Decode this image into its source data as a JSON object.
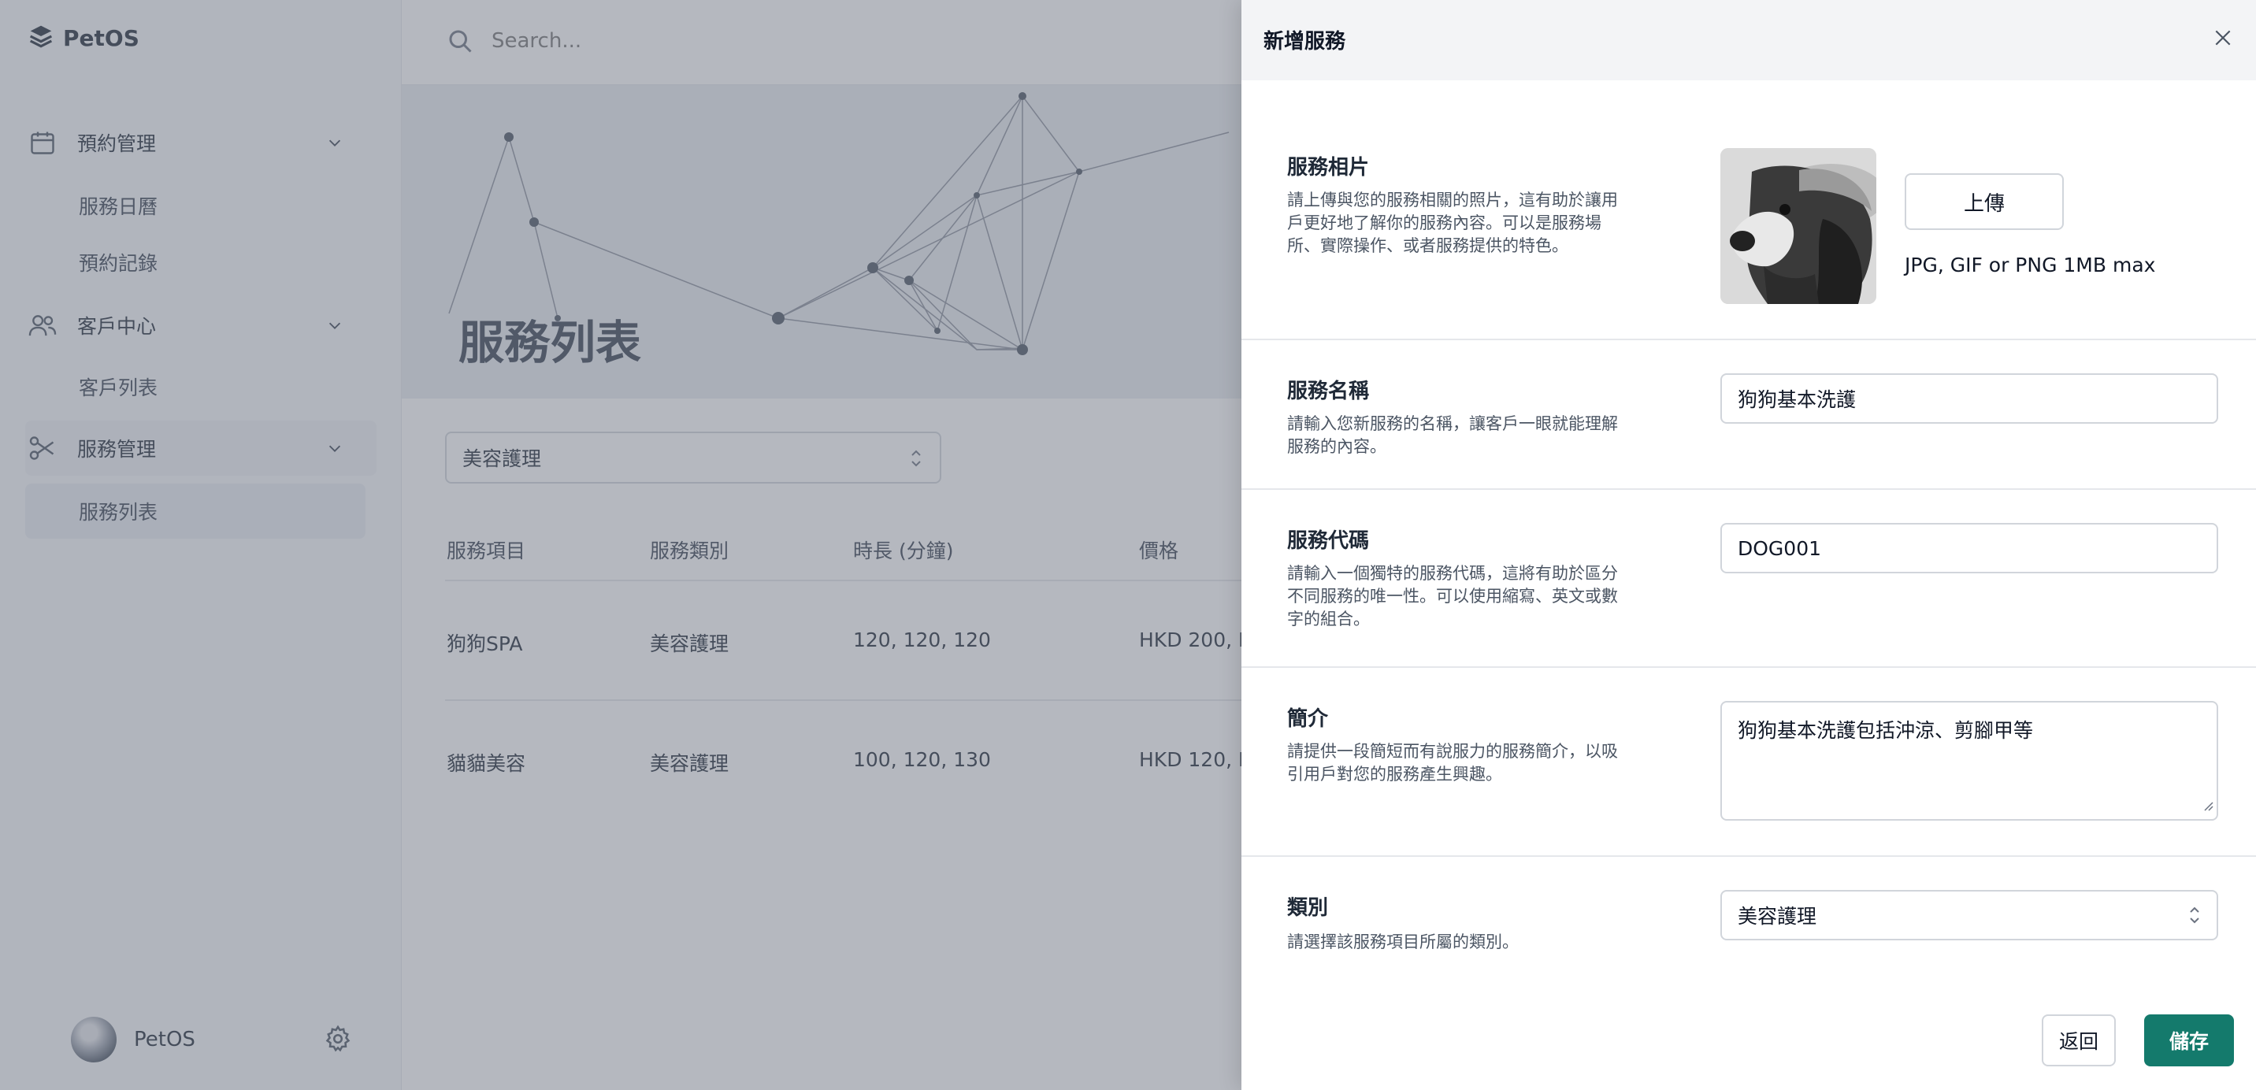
{
  "app": {
    "brand": "PetOS",
    "accent_color": "#147a6c"
  },
  "sidebar": {
    "groups": [
      {
        "label": "預約管理",
        "icon": "calendar-icon",
        "items": [
          "服務日曆",
          "預約記錄"
        ]
      },
      {
        "label": "客戶中心",
        "icon": "users-icon",
        "items": [
          "客戶列表"
        ]
      },
      {
        "label": "服務管理",
        "icon": "scissors-icon",
        "items": [
          "服務列表"
        ]
      }
    ],
    "active_item": "服務列表",
    "profile_name": "PetOS"
  },
  "topbar": {
    "search_placeholder": "Search..."
  },
  "page": {
    "title": "服務列表",
    "filter_value": "美容護理",
    "columns": [
      "服務項目",
      "服務類別",
      "時長 (分鐘)",
      "價格"
    ],
    "rows": [
      {
        "name": "狗狗SPA",
        "category": "美容護理",
        "duration": "120, 120, 120",
        "price": "HKD 200, H"
      },
      {
        "name": "貓貓美容",
        "category": "美容護理",
        "duration": "100, 120, 130",
        "price": "HKD 120, H"
      }
    ]
  },
  "drawer": {
    "title": "新增服務",
    "photo": {
      "title": "服務相片",
      "desc": "請上傳與您的服務相關的照片，這有助於讓用戶更好地了解你的服務內容。可以是服務場所、實際操作、或者服務提供的特色。",
      "upload_label": "上傳",
      "hint": "JPG, GIF or PNG 1MB max"
    },
    "name": {
      "title": "服務名稱",
      "desc": "請輸入您新服務的名稱，讓客戶一眼就能理解服務的內容。",
      "value": "狗狗基本洗護"
    },
    "code": {
      "title": "服務代碼",
      "desc": "請輸入一個獨特的服務代碼，這將有助於區分不同服務的唯一性。可以使用縮寫、英文或數字的組合。",
      "value": "DOG001"
    },
    "intro": {
      "title": "簡介",
      "desc": "請提供一段簡短而有說服力的服務簡介，以吸引用戶對您的服務產生興趣。",
      "value": "狗狗基本洗護包括沖涼、剪腳甲等"
    },
    "category": {
      "title": "類別",
      "desc": "請選擇該服務項目所屬的類別。",
      "value": "美容護理"
    },
    "back_label": "返回",
    "save_label": "儲存"
  }
}
